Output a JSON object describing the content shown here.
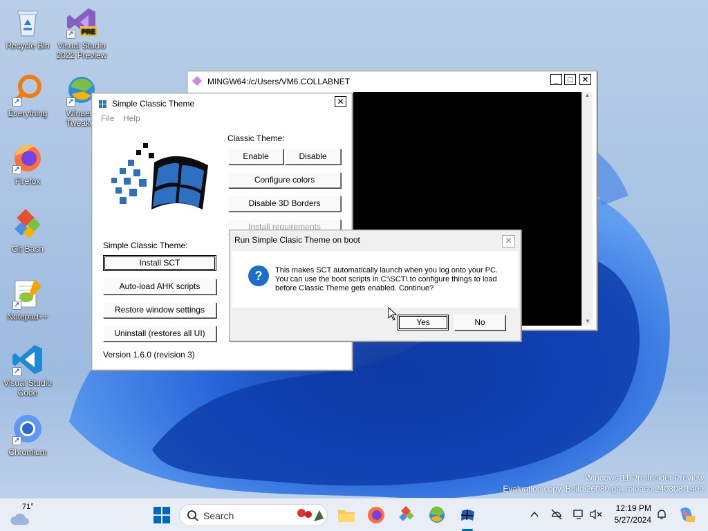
{
  "desktop": {
    "icons": [
      {
        "label": "Recycle Bin",
        "icon": "recycle-bin-icon"
      },
      {
        "label": "Visual Studio 2022 Preview",
        "icon": "visual-studio-preview-icon",
        "badge": "PRE"
      },
      {
        "label": "Everything",
        "icon": "everything-search-icon"
      },
      {
        "label": "Winaero Tweaker",
        "icon": "winaero-tweaker-icon"
      },
      {
        "label": "Firefox",
        "icon": "firefox-icon"
      },
      {
        "label": "Git Bash",
        "icon": "git-bash-icon"
      },
      {
        "label": "Notepad++",
        "icon": "notepadpp-icon"
      },
      {
        "label": "Visual Studio Code",
        "icon": "vscode-icon"
      },
      {
        "label": "Chromium",
        "icon": "chromium-icon"
      }
    ],
    "watermark_line1": "Windows 11 Pro Insider Preview",
    "watermark_line2": "Evaluation copy. Build 26080.ge_release.240308-1400"
  },
  "mingw": {
    "title": "MINGW64:/c/Users/VM6.COLLABNET"
  },
  "sct": {
    "title": "Simple Classic Theme",
    "menu_file": "File",
    "menu_help": "Help",
    "classic_theme_label": "Classic Theme:",
    "enable_label": "Enable",
    "disable_label": "Disable",
    "configure_colors_label": "Configure colors",
    "disable_3d_label": "Disable 3D Borders",
    "install_requirements_label": "Install requirements",
    "sct_label": "Simple Classic Theme:",
    "install_sct_label": "Install SCT",
    "autoload_label": "Auto-load AHK scripts",
    "restore_label": "Restore window settings",
    "uninstall_label": "Uninstall (restores all UI)",
    "version": "Version 1.6.0 (revision 3)"
  },
  "dialog": {
    "title": "Run Simple Clasic Theme on boot",
    "message": "This makes SCT automatically launch when you log onto your PC. You can use the boot scripts in C:\\SCT\\ to configure things to load before Classic Theme gets enabled. Continue?",
    "yes_label": "Yes",
    "no_label": "No"
  },
  "taskbar": {
    "weather_temp": "71°",
    "search_placeholder": "Search",
    "time": "12:19 PM",
    "date": "5/27/2024"
  },
  "colors": {
    "accent": "#0067c0",
    "dialog_icon": "#1a6fc9",
    "terminal_bg": "#000000"
  }
}
